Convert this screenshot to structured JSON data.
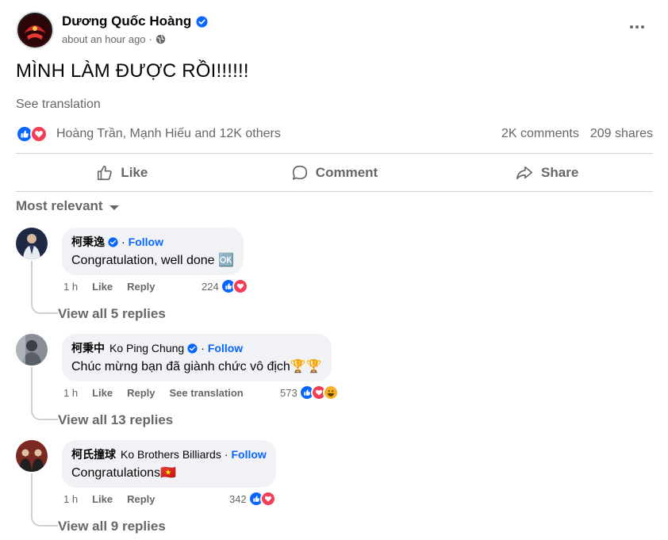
{
  "post": {
    "author": "Dương Quốc Hoàng",
    "timestamp": "about an hour ago",
    "timestamp_separator": "·",
    "privacy_icon": "globe-icon",
    "text": "MÌNH LÀM ĐƯỢC RỒI!!!!!!",
    "see_translation": "See translation",
    "reaction_names": "Hoàng Trần, Mạnh Hiếu and 12K others",
    "comments_count": "2K comments",
    "shares_count": "209 shares"
  },
  "actions": {
    "like": "Like",
    "comment": "Comment",
    "share": "Share"
  },
  "sort_label": "Most relevant",
  "comments": [
    {
      "name": "柯秉逸",
      "sub": "",
      "verified": true,
      "follow": "Follow",
      "text": "Congratulation, well done 🆗",
      "time": "1 h",
      "like": "Like",
      "reply": "Reply",
      "translate": "",
      "reaction_count": "224",
      "view_replies": "View all 5 replies"
    },
    {
      "name": "柯秉中",
      "sub": "Ko Ping Chung",
      "verified": true,
      "follow": "Follow",
      "text": "Chúc mừng bạn đã giành chức vô địch🏆🏆",
      "time": "1 h",
      "like": "Like",
      "reply": "Reply",
      "translate": "See translation",
      "reaction_count": "573",
      "view_replies": "View all 13 replies"
    },
    {
      "name": "柯氏撞球",
      "sub": "Ko Brothers Billiards",
      "verified": false,
      "follow": "Follow",
      "text": "Congratulations🇻🇳",
      "time": "1 h",
      "like": "Like",
      "reply": "Reply",
      "translate": "",
      "reaction_count": "342",
      "view_replies": "View all 9 replies"
    }
  ],
  "colors": {
    "like_blue": "#0866ff",
    "love_red": "#f33e58",
    "haha_yellow": "#f7b125",
    "muted_text": "#65676b",
    "bubble_bg": "#f0f2f5"
  }
}
